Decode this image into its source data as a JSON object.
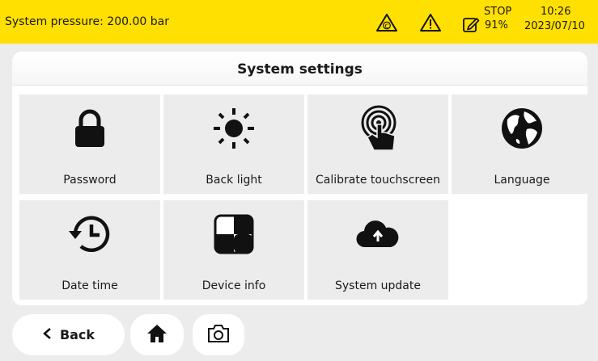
{
  "status_bar": {
    "pressure": "System pressure: 200.00 bar",
    "stop_label": "STOP",
    "percent": "91%",
    "time": "10:26",
    "date": "2023/07/10",
    "background_color": "#ffe000",
    "icons": [
      "warning-c-icon",
      "warning-icon",
      "edit-icon"
    ]
  },
  "panel": {
    "title": "System settings"
  },
  "tiles": [
    {
      "label": "Password",
      "icon": "lock-icon"
    },
    {
      "label": "Back light",
      "icon": "sun-icon"
    },
    {
      "label": "Calibrate touchscreen",
      "icon": "touch-target-icon"
    },
    {
      "label": "Language",
      "icon": "globe-icon"
    },
    {
      "label": "Date time",
      "icon": "history-clock-icon"
    },
    {
      "label": "Device info",
      "icon": "device-info-icon"
    },
    {
      "label": "System update",
      "icon": "cloud-upload-icon"
    }
  ],
  "bottom": {
    "back_label": "Back",
    "icons": [
      "chevron-left-icon",
      "home-icon",
      "camera-icon"
    ]
  }
}
